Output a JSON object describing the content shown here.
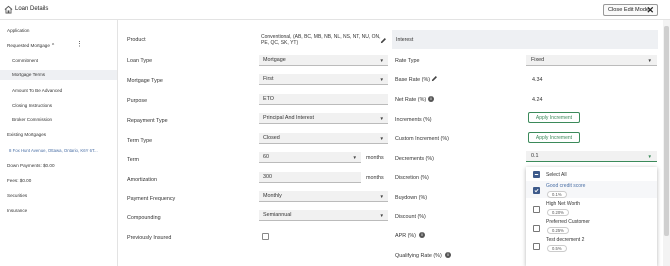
{
  "header": {
    "title": "Loan Details",
    "close_label": "Close Edit Mode"
  },
  "sidebar": {
    "items": [
      {
        "label": "Application"
      },
      {
        "label": "Requested Mortgage"
      },
      {
        "label": "Commitment"
      },
      {
        "label": "Mortgage Terms"
      },
      {
        "label": "Amount To Be Advanced"
      },
      {
        "label": "Closing Instructions"
      },
      {
        "label": "Broker Commission"
      },
      {
        "label": "Existing Mortgages"
      },
      {
        "label": "8 Fox Hunt Avenue, Ottawa, Ontario, K6Y 6T..."
      },
      {
        "label": "Down Payments: $0.00"
      },
      {
        "label": "Fees: $0.00"
      },
      {
        "label": "Securities"
      },
      {
        "label": "Insurance"
      }
    ]
  },
  "form": {
    "product": {
      "label": "Product",
      "value": "Conventional, (AB, BC, MB, NB, NL, NS, NT, NU, ON, PE, QC, SK, YT)"
    },
    "loan_type": {
      "label": "Loan Type",
      "value": "Mortgage"
    },
    "mortgage_type": {
      "label": "Mortgage Type",
      "value": "First"
    },
    "purpose": {
      "label": "Purpose",
      "value": "ETO"
    },
    "repayment_type": {
      "label": "Repayment Type",
      "value": "Principal And Interest"
    },
    "term_type": {
      "label": "Term Type",
      "value": "Closed"
    },
    "term": {
      "label": "Term",
      "value": "60",
      "unit": "months"
    },
    "amortization": {
      "label": "Amortization",
      "value": "300",
      "unit": "months"
    },
    "payment_frequency": {
      "label": "Payment Frequency",
      "value": "Monthly"
    },
    "compounding": {
      "label": "Compounding",
      "value": "Semiannual"
    },
    "previously_insured": {
      "label": "Previously Insured",
      "checked": false
    }
  },
  "interest": {
    "title": "Interest",
    "rate_type": {
      "label": "Rate Type",
      "value": "Fixed"
    },
    "base_rate": {
      "label": "Base Rate (%)",
      "value": "4.34"
    },
    "net_rate": {
      "label": "Net Rate (%)",
      "value": "4.24"
    },
    "increments": {
      "label": "Increments (%)",
      "button": "Apply Increment"
    },
    "custom_increment": {
      "label": "Custom Increment (%)",
      "button": "Apply Increment"
    },
    "decrements": {
      "label": "Decrements (%)",
      "value": "0.1"
    },
    "discretion": {
      "label": "Discretion (%)"
    },
    "buydown": {
      "label": "Buydown (%)"
    },
    "discount": {
      "label": "Discount (%)"
    },
    "apr": {
      "label": "APR (%)"
    },
    "qualifying_rate": {
      "label": "Qualifying Rate (%)"
    }
  },
  "decrement_options": {
    "select_all": "Select All",
    "options": [
      {
        "name": "Good credit score",
        "value": "0.1%",
        "checked": true
      },
      {
        "name": "High Net Worth",
        "value": "0.20%",
        "checked": false
      },
      {
        "name": "Preferred Customer",
        "value": "0.25%",
        "checked": false
      },
      {
        "name": "Test decrement 2",
        "value": "0.5%",
        "checked": false
      }
    ]
  },
  "colors": {
    "accent_green": "#3b8a5a",
    "checkbox_blue": "#3d5a8a",
    "link_blue": "#4a6fa5"
  },
  "icons": {
    "home": "home-icon",
    "close": "close-icon",
    "pencil": "pencil-icon",
    "info": "info-icon",
    "dropdown": "chevron-down-icon"
  }
}
